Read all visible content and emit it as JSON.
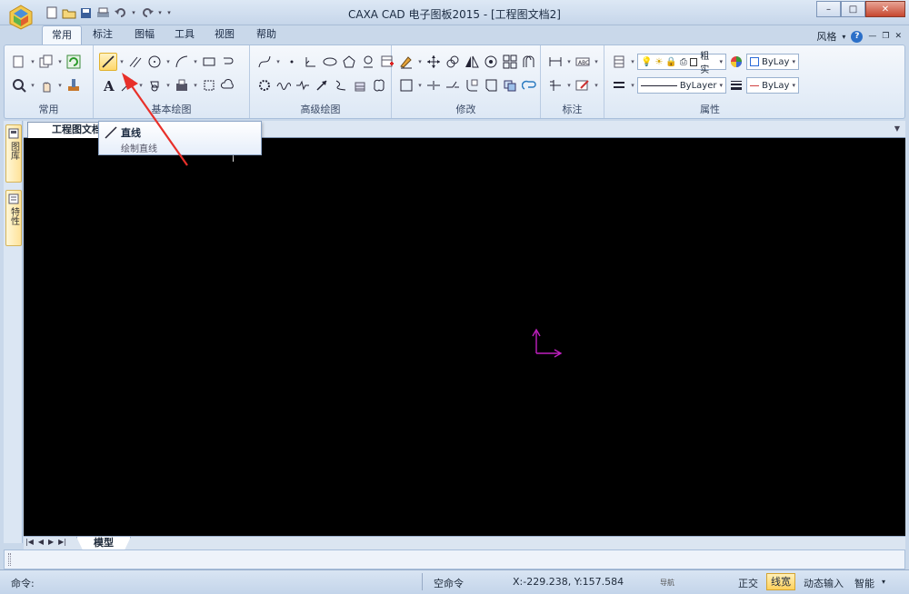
{
  "window": {
    "title": "CAXA CAD 电子图板2015 - [工程图文档2]",
    "controls": {
      "minimize": "–",
      "maximize": "□",
      "close": "✕"
    }
  },
  "ribbon_tabs": [
    "常用",
    "标注",
    "图幅",
    "工具",
    "视图",
    "帮助"
  ],
  "active_tab": "常用",
  "style_menu": {
    "label": "风格",
    "arrow": "▾",
    "help": "?"
  },
  "groups": {
    "common": "常用",
    "basic_draw": "基本绘图",
    "advanced_draw": "高级绘图",
    "modify": "修改",
    "dimension": "标注",
    "properties": "属性"
  },
  "properties": {
    "layer_name": "粗实",
    "color_value": "ByLay",
    "linetype_value": "ByLayer",
    "lineweight_value": "ByLay",
    "color_swatch": "#ffffff",
    "lineweight_color": "#d04040"
  },
  "tooltip": {
    "title": "直线",
    "description": "绘制直线"
  },
  "document_tab": "工程图文档2",
  "side_tabs": {
    "library": "图库",
    "properties": "特性"
  },
  "layout_tab": "模型",
  "status": {
    "command_prompt": "命令:",
    "idle": "空命令",
    "coordinates": "X:-229.238, Y:157.584",
    "snap_mode": "导航",
    "ortho": "正交",
    "lineweight": "线宽",
    "dynamic_input": "动态输入",
    "smart": "智能"
  },
  "colors": {
    "annotation_arrow": "#e8302a",
    "ucs_axes": "#c020c0",
    "canvas": "#000000"
  }
}
